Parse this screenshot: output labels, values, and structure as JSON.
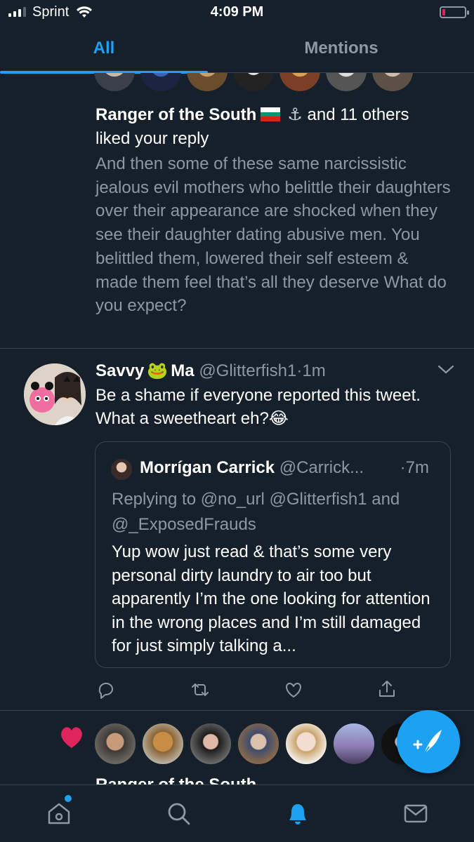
{
  "status_bar": {
    "carrier": "Sprint",
    "time": "4:09 PM",
    "signal_bars": 4,
    "battery_level": 0.1
  },
  "tabs": [
    {
      "label": "All",
      "active": true
    },
    {
      "label": "Mentions",
      "active": false
    }
  ],
  "notification": {
    "actor": "Ranger of the South",
    "actor_flag_icon": "bulgaria-flag-icon",
    "actor_symbol": "⚓",
    "others": "and 11 others",
    "action": "liked your reply",
    "quoted_text": "And then some of these same narcissistic jealous evil mothers who belittle their daughters over their appearance are shocked when they see their daughter dating abusive men. You belittled them, lowered their self esteem & made them feel that’s all they deserve What do you expect?"
  },
  "tweet": {
    "name_part1": "Savvy",
    "emoji": "🐸",
    "name_part2": "Ma",
    "handle": "@Glitterfish1",
    "dot": "·",
    "time": "1m",
    "text": "Be a shame if everyone reported this tweet. What a sweetheart eh?😂",
    "quote": {
      "name": "Morrígan Carrick",
      "handle": "@Carrick...",
      "time": "·7m",
      "replying": "Replying to @no_url @Glitterfish1 and @_ExposedFrauds",
      "text": "Yup wow just read & that’s some very personal dirty laundry to air too but apparently I’m the one looking for attention in the wrong places and I’m still damaged for just simply talking a..."
    }
  },
  "next_notification_partial": "Ranger of the South",
  "colors": {
    "background": "#15202b",
    "accent": "#1da1f2",
    "muted_text": "#8b98a5",
    "divider": "#38444d",
    "like": "#e0245e"
  },
  "icons": [
    "wifi-icon",
    "chevron-down-icon",
    "reply-icon",
    "retweet-icon",
    "like-icon",
    "share-icon",
    "heart-icon",
    "compose-icon",
    "home-icon",
    "search-icon",
    "notifications-icon",
    "messages-icon"
  ]
}
